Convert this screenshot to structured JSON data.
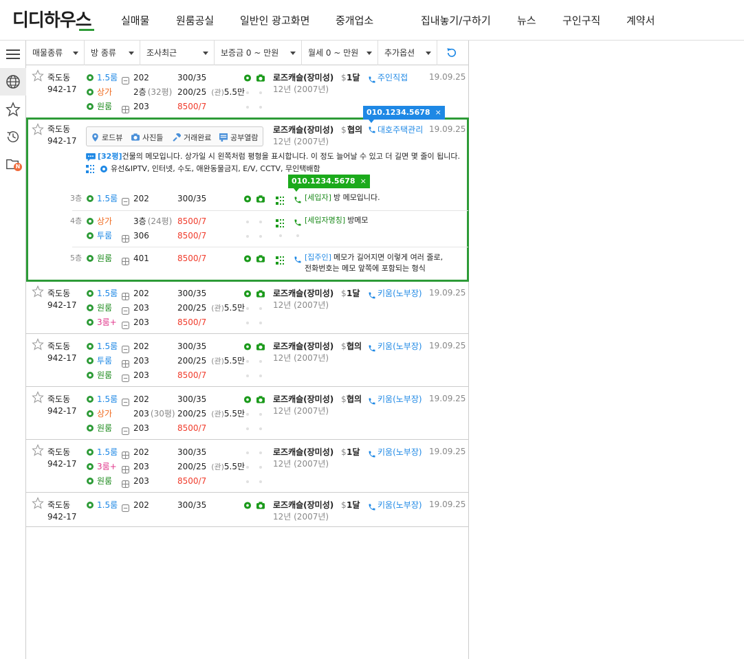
{
  "header": {
    "logo": "디디하우스",
    "nav": [
      "실매물",
      "원룸공실",
      "일반인 광고화면",
      "중개업소",
      "집내놓기/구하기",
      "뉴스",
      "구인구직",
      "계약서"
    ]
  },
  "sidebar": {
    "icons": [
      "menu-icon",
      "globe-icon",
      "star-icon",
      "history-icon",
      "folder-icon"
    ],
    "new_badge": "N"
  },
  "filters": {
    "type": "매물종류",
    "room": "방 종류",
    "survey": "조사최근",
    "deposit": "보증금 0 ~ 만원",
    "rent": "월세 0 ~ 만원",
    "extra": "추가옵션"
  },
  "listings": [
    {
      "dong": "죽도동",
      "bunji": "942-17",
      "rooms": [
        {
          "type": "1.5룸",
          "unit": "202",
          "price": "300/35",
          "price_color": "black"
        },
        {
          "type": "상가",
          "unit": "2층",
          "size": "(32평)",
          "price": "200/25",
          "mgmt_label": "(관)",
          "mgmt": "5.5만",
          "price_color": "black"
        },
        {
          "type": "원룸",
          "unit": "203",
          "price": "8500/7",
          "price_color": "red"
        }
      ],
      "building": "로즈캐슬(장미성)",
      "age": "12년 (2007년)",
      "pay_sym": "$",
      "pay": "1달",
      "agent": "주인직접",
      "date": "19.09.25"
    },
    {
      "dong": "죽도동",
      "bunji": "942-17",
      "rooms": [
        {
          "type": "1.5룸",
          "unit": "202",
          "price": "300/35",
          "price_color": "black"
        },
        {
          "type": "원룸",
          "unit": "203",
          "price": "200/25",
          "mgmt_label": "(관)",
          "mgmt": "5.5만",
          "price_color": "black"
        },
        {
          "type": "3룸+",
          "unit": "203",
          "price": "8500/7",
          "price_color": "red"
        }
      ],
      "building": "로즈캐슬(장미성)",
      "age": "12년 (2007년)",
      "pay_sym": "$",
      "pay": "1달",
      "agent": "키움(노부장)",
      "date": "19.09.25"
    },
    {
      "dong": "죽도동",
      "bunji": "942-17",
      "rooms": [
        {
          "type": "1.5룸",
          "unit": "202",
          "price": "300/35",
          "price_color": "black"
        },
        {
          "type": "투룸",
          "unit": "203",
          "price": "200/25",
          "mgmt_label": "(관)",
          "mgmt": "5.5만",
          "price_color": "black"
        },
        {
          "type": "원룸",
          "unit": "203",
          "price": "8500/7",
          "price_color": "red"
        }
      ],
      "building": "로즈캐슬(장미성)",
      "age": "12년 (2007년)",
      "pay_sym": "$",
      "pay": "협의",
      "agent": "키움(노부장)",
      "date": "19.09.25"
    },
    {
      "dong": "죽도동",
      "bunji": "942-17",
      "rooms": [
        {
          "type": "1.5룸",
          "unit": "202",
          "price": "300/35",
          "price_color": "black"
        },
        {
          "type": "상가",
          "unit": "203",
          "size": "(30평)",
          "price": "200/25",
          "mgmt_label": "(관)",
          "mgmt": "5.5만",
          "price_color": "black"
        },
        {
          "type": "원룸",
          "unit": "203",
          "price": "8500/7",
          "price_color": "red"
        }
      ],
      "building": "로즈캐슬(장미성)",
      "age": "12년 (2007년)",
      "pay_sym": "$",
      "pay": "협의",
      "agent": "키움(노부장)",
      "date": "19.09.25"
    },
    {
      "dong": "죽도동",
      "bunji": "942-17",
      "rooms": [
        {
          "type": "1.5룸",
          "unit": "202",
          "price": "300/35",
          "price_color": "black"
        },
        {
          "type": "3룸+",
          "unit": "203",
          "price": "200/25",
          "mgmt_label": "(관)",
          "mgmt": "5.5만",
          "price_color": "black"
        },
        {
          "type": "원룸",
          "unit": "203",
          "price": "8500/7",
          "price_color": "red"
        }
      ],
      "building": "로즈캐슬(장미성)",
      "age": "12년 (2007년)",
      "pay_sym": "$",
      "pay": "1달",
      "agent": "키움(노부장)",
      "date": "19.09.25"
    },
    {
      "dong": "죽도동",
      "bunji": "942-17",
      "rooms": [
        {
          "type": "1.5룸",
          "unit": "202",
          "price": "300/35",
          "price_color": "black"
        }
      ],
      "building": "로즈캐슬(장미성)",
      "age": "12년 (2007년)",
      "pay_sym": "$",
      "pay": "1달",
      "agent": "키움(노부장)",
      "date": "19.09.25"
    }
  ],
  "selected": {
    "dong": "죽도동",
    "bunji": "942-17",
    "tools": [
      "로드뷰",
      "사진들",
      "거래완료",
      "공부열람"
    ],
    "building": "로즈캐슬(장미성)",
    "age": "12년 (2007년)",
    "pay_sym": "$",
    "pay": "협의",
    "agent": "대호주택관리",
    "date": "19.09.25",
    "agent_phone": "010.1234.5678",
    "close": "×",
    "memo_size": "[32평]",
    "memo": "건물의 메모입니다. 상가일 시 왼쪽처럼 평형을 표시합니다. 이 정도 늘어날 수 있고 더 길면 몇 줄이 됩니다.",
    "options": "유선&IPTV, 인터넷, 수도, 애완동물금지, E/V, CCTV, 무인택배함",
    "floors": [
      {
        "floor": "3층",
        "type": "1.5룸",
        "unit": "202",
        "price": "300/35",
        "tenant": "[세입자]",
        "memo": "방 메모입니다.",
        "phone": "010.1234.5678"
      },
      {
        "floor": "4층",
        "type": "상가",
        "unit": "3층",
        "size": "(24평)",
        "price": "8500/7",
        "tenant": "[세입자명칭]",
        "memo": "방메모"
      },
      {
        "floor": "",
        "type": "투룸",
        "unit": "306",
        "price": "8500/7"
      },
      {
        "floor": "5층",
        "type": "원룸",
        "unit": "401",
        "price": "8500/7",
        "tenant": "[집주인]",
        "memo": "메모가 길어지면 이렇게 여러 줄로,",
        "memo2": "전화번호는 메모 앞쪽에 포함되는 형식"
      }
    ]
  },
  "colors": {
    "accent": "#2d9b37",
    "blue": "#1e88e5",
    "red": "#f03a2a",
    "orange": "#f06a1e",
    "pink": "#e13a8c"
  }
}
